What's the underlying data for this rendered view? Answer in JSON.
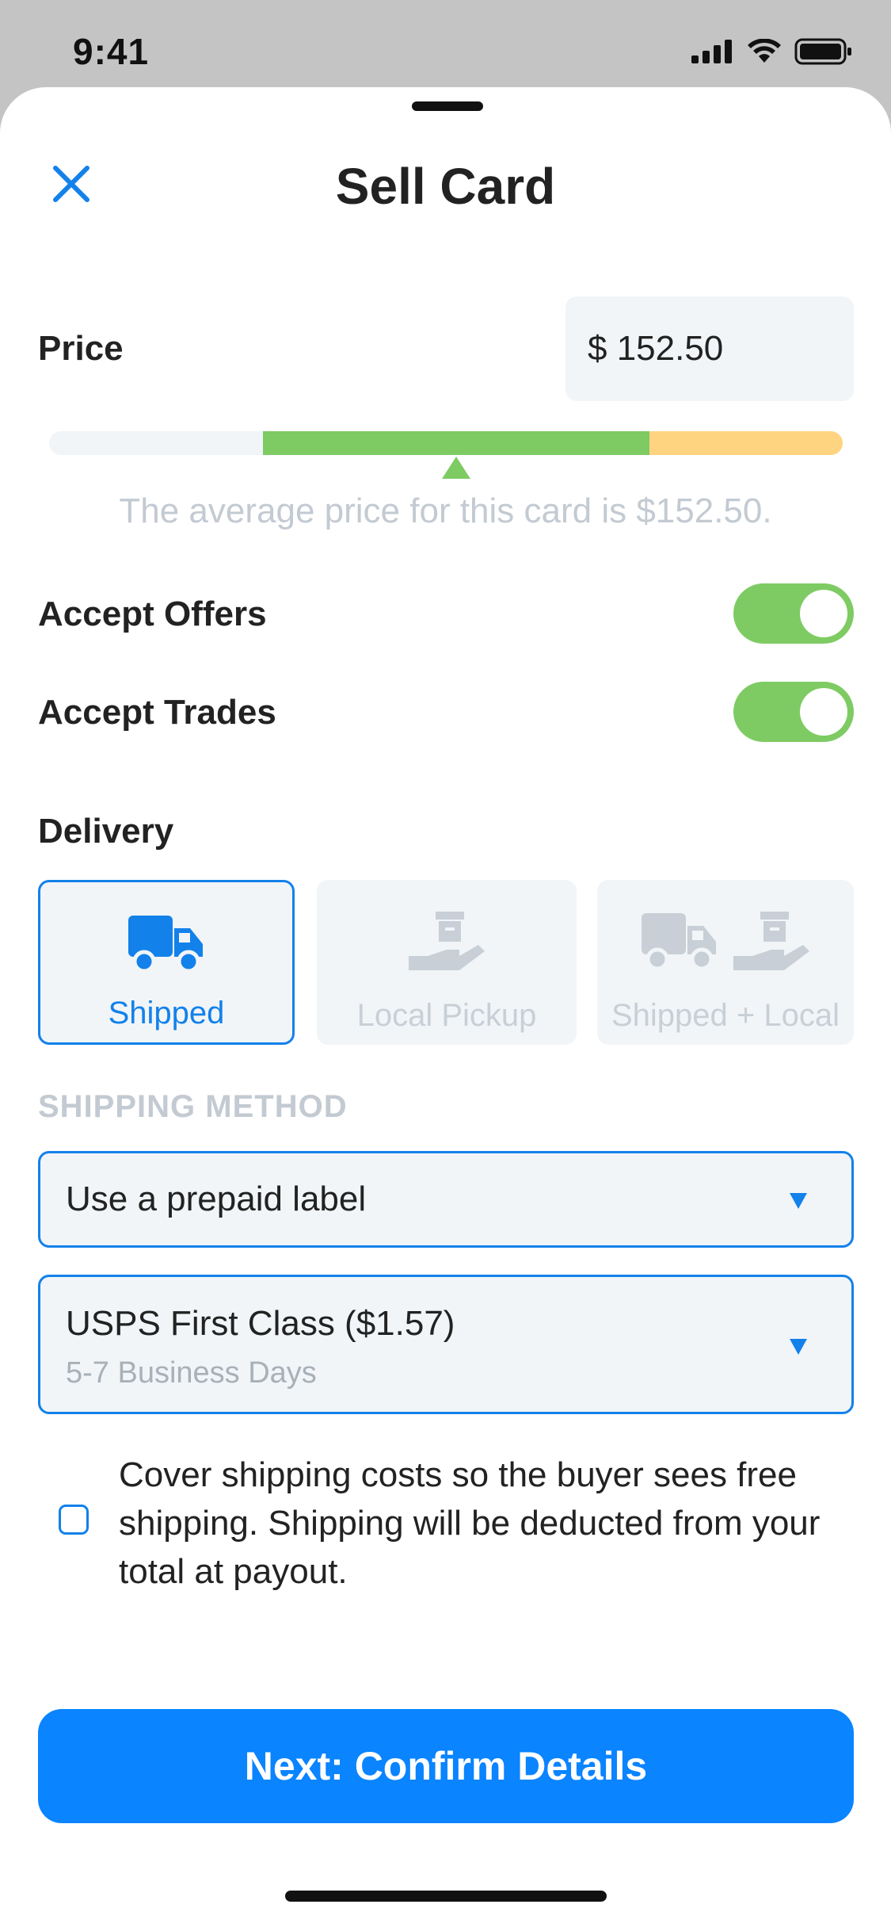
{
  "status_bar": {
    "time": "9:41"
  },
  "header": {
    "title": "Sell Card"
  },
  "price": {
    "label": "Price",
    "value": "$ 152.50",
    "average_note": "The average price for this card is $152.50."
  },
  "toggles": [
    {
      "label": "Accept Offers",
      "on": true
    },
    {
      "label": "Accept Trades",
      "on": true
    }
  ],
  "delivery": {
    "label": "Delivery",
    "options": [
      {
        "label": "Shipped",
        "selected": true
      },
      {
        "label": "Local Pickup",
        "selected": false
      },
      {
        "label": "Shipped + Local",
        "selected": false
      }
    ]
  },
  "shipping": {
    "section_label": "SHIPPING METHOD",
    "label_select": "Use a prepaid label",
    "carrier_select": "USPS First Class ($1.57)",
    "carrier_sub": "5-7 Business Days",
    "cover_text": "Cover shipping costs so the buyer sees free shipping. Shipping will be deducted from your total at payout.",
    "cover_checked": false
  },
  "cta": {
    "label": "Next: Confirm Details"
  },
  "colors": {
    "accent": "#0a84ff",
    "toggle_on": "#7ecb63",
    "range_green": "#7ecb63",
    "range_yellow": "#ffd480",
    "muted": "#c3cad2"
  }
}
